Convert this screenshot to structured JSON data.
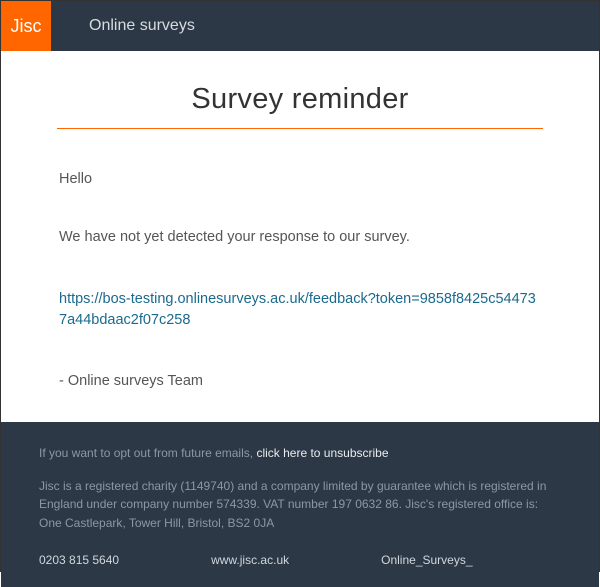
{
  "header": {
    "logo_text": "Jisc",
    "product_name": "Online surveys"
  },
  "main": {
    "title": "Survey reminder",
    "greeting": "Hello",
    "message": "We have not yet detected your response to our survey.",
    "survey_link": "https://bos-testing.onlinesurveys.ac.uk/feedback?token=9858f8425c544737a44bdaac2f07c258",
    "signoff": "- Online surveys Team"
  },
  "footer": {
    "opt_out_prefix": "If you want to opt out from future emails, ",
    "unsubscribe_label": "click here to unsubscribe",
    "legal": "Jisc is a registered charity (1149740) and a company limited by guarantee which is registered in England under company number 574339. VAT number 197 0632 86. Jisc's registered office is: One Castlepark, Tower Hill, Bristol, BS2 0JA",
    "phone": "0203 815 5640",
    "website": "www.jisc.ac.uk",
    "social": "Online_Surveys_"
  },
  "colors": {
    "brand_orange": "#ff6600",
    "dark_bg": "#2d3846",
    "link_blue": "#1a6a8e"
  }
}
